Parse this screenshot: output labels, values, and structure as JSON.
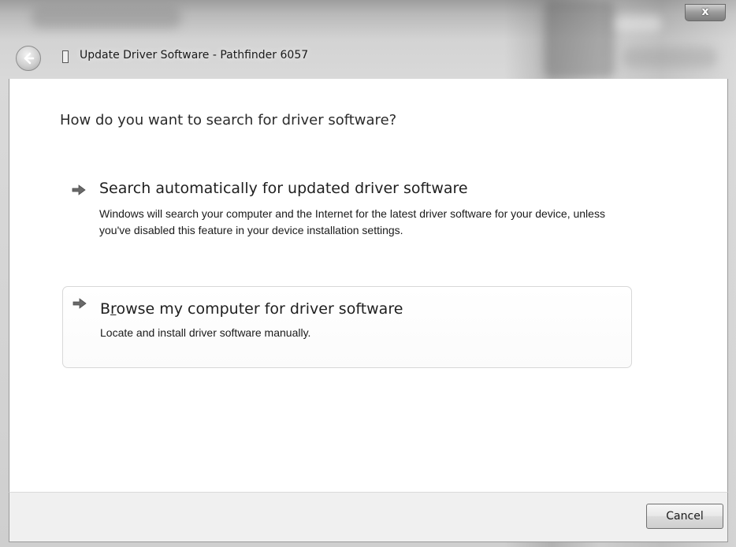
{
  "window": {
    "title": "Update Driver Software - Pathfinder 6057",
    "close_label": "x",
    "icons": {
      "back": "back-arrow-icon",
      "device": "device-icon",
      "option_arrow": "green-arrow-icon"
    }
  },
  "main": {
    "heading": "How do you want to search for driver software?",
    "options": [
      {
        "title": "Search automatically for updated driver software",
        "description": "Windows will search your computer and the Internet for the latest driver software for your device, unless you've disabled this feature in your device installation settings."
      },
      {
        "title_pre": "B",
        "title_accel": "r",
        "title_post": "owse my computer for driver software",
        "description": "Locate and install driver software manually."
      }
    ]
  },
  "footer": {
    "cancel_label": "Cancel"
  },
  "colors": {
    "frame": "#d3d3d3",
    "content_bg": "#ffffff",
    "footer_bg": "#f0f0f0",
    "text": "#1f1f1f"
  }
}
